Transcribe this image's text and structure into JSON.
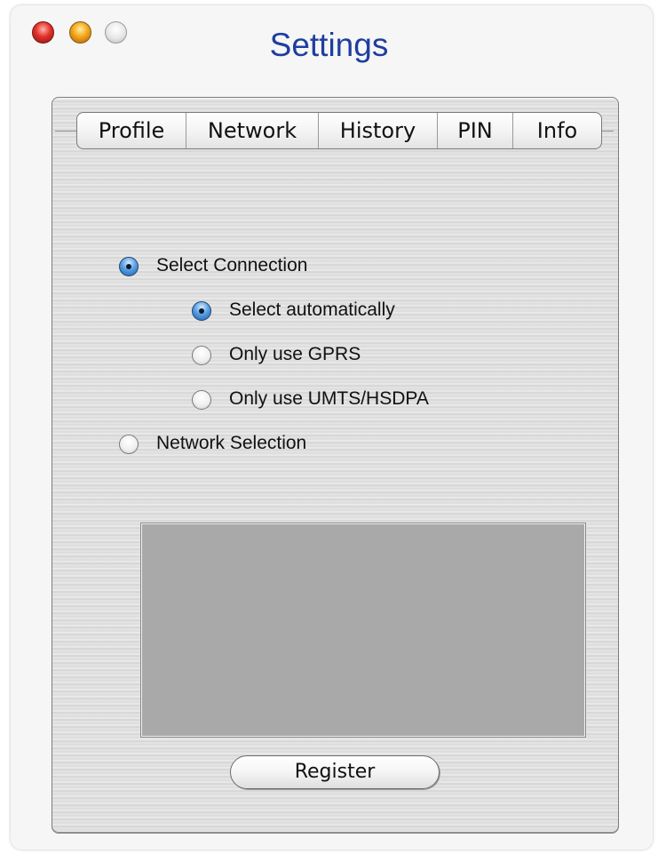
{
  "window": {
    "title": "Settings",
    "controls": {
      "close": "close-icon",
      "minimize": "minimize-icon",
      "zoom": "zoom-icon"
    }
  },
  "tabs": [
    {
      "label": "Profile"
    },
    {
      "label": "Network"
    },
    {
      "label": "History"
    },
    {
      "label": "PIN"
    },
    {
      "label": "Info"
    }
  ],
  "network": {
    "select_connection": {
      "label": "Select Connection",
      "checked": true
    },
    "options": [
      {
        "label": "Select automatically",
        "checked": true
      },
      {
        "label": "Only use GPRS",
        "checked": false
      },
      {
        "label": "Only use UMTS/HSDPA",
        "checked": false
      }
    ],
    "network_selection": {
      "label": "Network Selection",
      "checked": false
    },
    "register_label": "Register"
  },
  "colors": {
    "title": "#1f3e9e",
    "radio_selected": "#1f5fa6",
    "well": "#a9a9a9"
  }
}
